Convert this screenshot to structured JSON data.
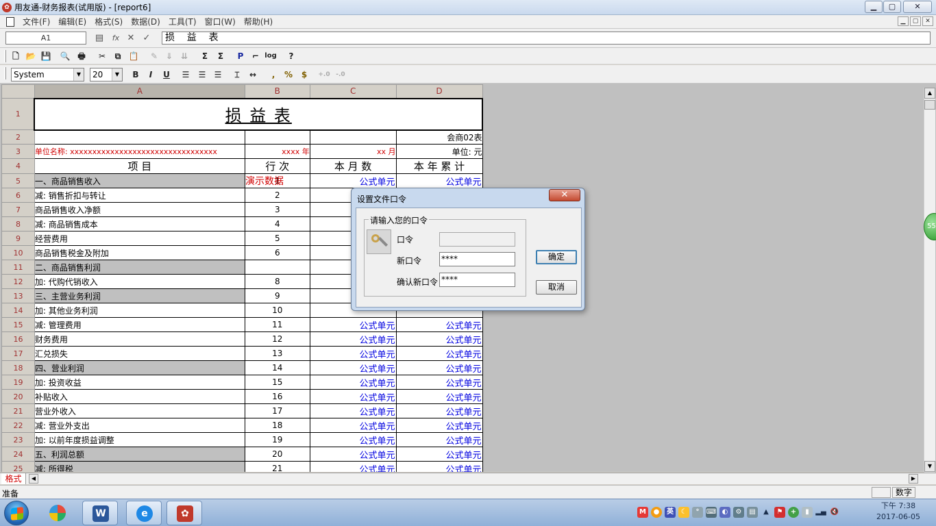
{
  "window": {
    "title": "用友通-财务报表(试用版) - [report6]",
    "minimize_glyph": "▁",
    "maximize_glyph": "▢",
    "close_glyph": "✕"
  },
  "menu": {
    "items": [
      "文件(F)",
      "编辑(E)",
      "格式(S)",
      "数据(D)",
      "工具(T)",
      "窗口(W)",
      "帮助(H)"
    ]
  },
  "formula_bar": {
    "cell_ref": "A1",
    "formula_value": "损    益    表",
    "fx_glyph": "fx",
    "cancel_glyph": "✕",
    "accept_glyph": "✓"
  },
  "format_toolbar": {
    "font_name": "System",
    "font_size": "20",
    "bold": "B",
    "italic": "I",
    "underline": "U",
    "percent": "%",
    "currency": "$",
    "comma": ",",
    "inc_decimal": "+.0",
    "dec_decimal": "-.0"
  },
  "toolbar_glyphs": {
    "sum": "Σ",
    "sum2": "Σ",
    "print_preview": "P",
    "log": "log",
    "help": "?"
  },
  "sheet": {
    "columns": [
      "A",
      "B",
      "C",
      "D"
    ],
    "title": "损    益    表",
    "form_no": "会商02表",
    "company_label": "单位名称:  xxxxxxxxxxxxxxxxxxxxxxxxxxxxxxxxx",
    "year_label": "xxxx  年",
    "month_label": "xx  月",
    "unit_label": "单位: 元",
    "header": {
      "item": "项                    目",
      "seq": "行    次",
      "month": "本  月  数",
      "ytd": "本 年 累 计"
    },
    "rows": [
      {
        "row": "5",
        "item": "    一、商品销售收入",
        "seq": "1",
        "month": "公式单元",
        "ytd": "公式单元",
        "grey": true
      },
      {
        "row": "6",
        "item": "        减: 销售折扣与转让",
        "seq": "2",
        "month": "",
        "ytd": "",
        "grey": false
      },
      {
        "row": "7",
        "item": "            商品销售收入净额",
        "seq": "3",
        "month": "",
        "ytd": "",
        "grey": false
      },
      {
        "row": "8",
        "item": "        减: 商品销售成本",
        "seq": "4",
        "month": "",
        "ytd": "",
        "grey": false
      },
      {
        "row": "9",
        "item": "            经营费用",
        "seq": "5",
        "month": "",
        "ytd": "",
        "grey": false
      },
      {
        "row": "10",
        "item": "            商品销售税金及附加",
        "seq": "6",
        "month": "",
        "ytd": "",
        "grey": false
      },
      {
        "row": "11",
        "item": "    二、商品销售利润",
        "seq": "",
        "month": "",
        "ytd": "",
        "grey": true
      },
      {
        "row": "12",
        "item": "        加: 代购代销收入",
        "seq": "8",
        "month": "",
        "ytd": "",
        "grey": false
      },
      {
        "row": "13",
        "item": "    三、主营业务利润",
        "seq": "9",
        "month": "",
        "ytd": "",
        "grey": true
      },
      {
        "row": "14",
        "item": "        加: 其他业务利润",
        "seq": "10",
        "month": "",
        "ytd": "",
        "grey": false
      },
      {
        "row": "15",
        "item": "        减: 管理费用",
        "seq": "11",
        "month": "公式单元",
        "ytd": "公式单元",
        "grey": false
      },
      {
        "row": "16",
        "item": "            财务费用",
        "seq": "12",
        "month": "公式单元",
        "ytd": "公式单元",
        "grey": false
      },
      {
        "row": "17",
        "item": "            汇兑损失",
        "seq": "13",
        "month": "公式单元",
        "ytd": "公式单元",
        "grey": false
      },
      {
        "row": "18",
        "item": "    四、营业利润",
        "seq": "14",
        "month": "公式单元",
        "ytd": "公式单元",
        "grey": true
      },
      {
        "row": "19",
        "item": "        加: 投资收益",
        "seq": "15",
        "month": "公式单元",
        "ytd": "公式单元",
        "grey": false
      },
      {
        "row": "20",
        "item": "            补贴收入",
        "seq": "16",
        "month": "公式单元",
        "ytd": "公式单元",
        "grey": false
      },
      {
        "row": "21",
        "item": "            营业外收入",
        "seq": "17",
        "month": "公式单元",
        "ytd": "公式单元",
        "grey": false
      },
      {
        "row": "22",
        "item": "        减: 营业外支出",
        "seq": "18",
        "month": "公式单元",
        "ytd": "公式单元",
        "grey": false
      },
      {
        "row": "23",
        "item": "        加: 以前年度损益调整",
        "seq": "19",
        "month": "公式单元",
        "ytd": "公式单元",
        "grey": false
      },
      {
        "row": "24",
        "item": "    五、利润总额",
        "seq": "20",
        "month": "公式单元",
        "ytd": "公式单元",
        "grey": true
      },
      {
        "row": "25",
        "item": "        减: 所得税",
        "seq": "21",
        "month": "公式单元",
        "ytd": "公式单元",
        "grey": true
      }
    ],
    "watermark": "演示数据",
    "sheet_tab": "格式"
  },
  "dialog": {
    "title": "设置文件口令",
    "close_glyph": "✕",
    "group_label": "请输入您的口令",
    "password_label": "口令",
    "password_value": "",
    "new_password_label": "新口令",
    "new_password_value": "****",
    "confirm_label": "确认新口令",
    "confirm_value": "****",
    "ok_label": "确定",
    "cancel_label": "取消"
  },
  "statusbar": {
    "status": "准备",
    "mode": "数字"
  },
  "taskbar": {
    "clock_period_time": "下午 7:38",
    "date": "2017-06-05",
    "bubble": "55"
  },
  "colors": {
    "formula_cell": "#0000e0",
    "accent_red": "#d00000",
    "grey_row": "#c0c0c0"
  }
}
